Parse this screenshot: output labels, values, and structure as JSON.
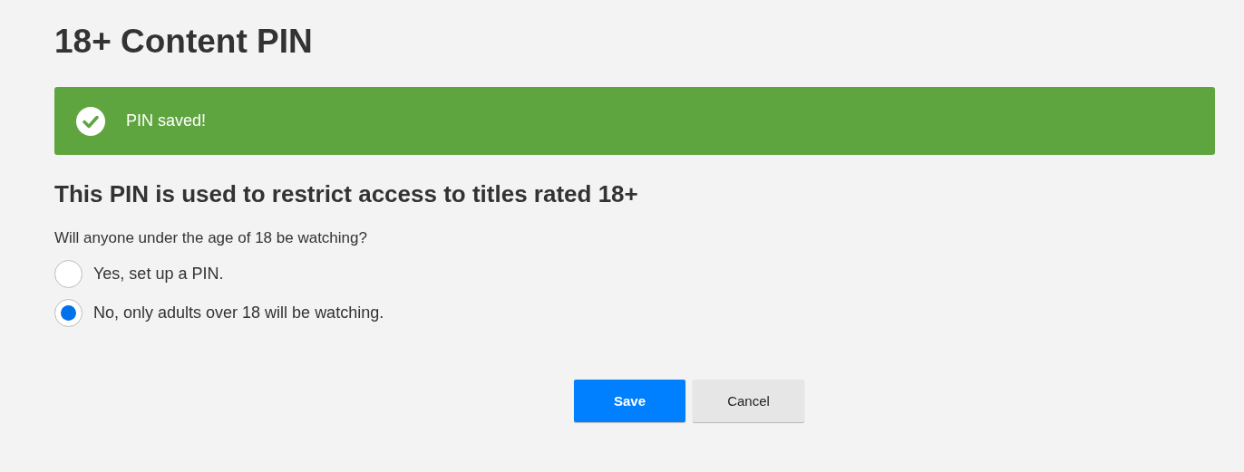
{
  "page": {
    "title": "18+ Content PIN"
  },
  "alert": {
    "kind": "success",
    "message": "PIN saved!"
  },
  "section": {
    "heading": "This PIN is used to restrict access to titles rated 18+",
    "question": "Will anyone under the age of 18 be watching?"
  },
  "options": [
    {
      "label": "Yes, set up a PIN.",
      "selected": false
    },
    {
      "label": "No, only adults over 18 will be watching.",
      "selected": true
    }
  ],
  "buttons": [
    {
      "label": "Save",
      "kind": "primary"
    },
    {
      "label": "Cancel",
      "kind": "secondary"
    }
  ]
}
